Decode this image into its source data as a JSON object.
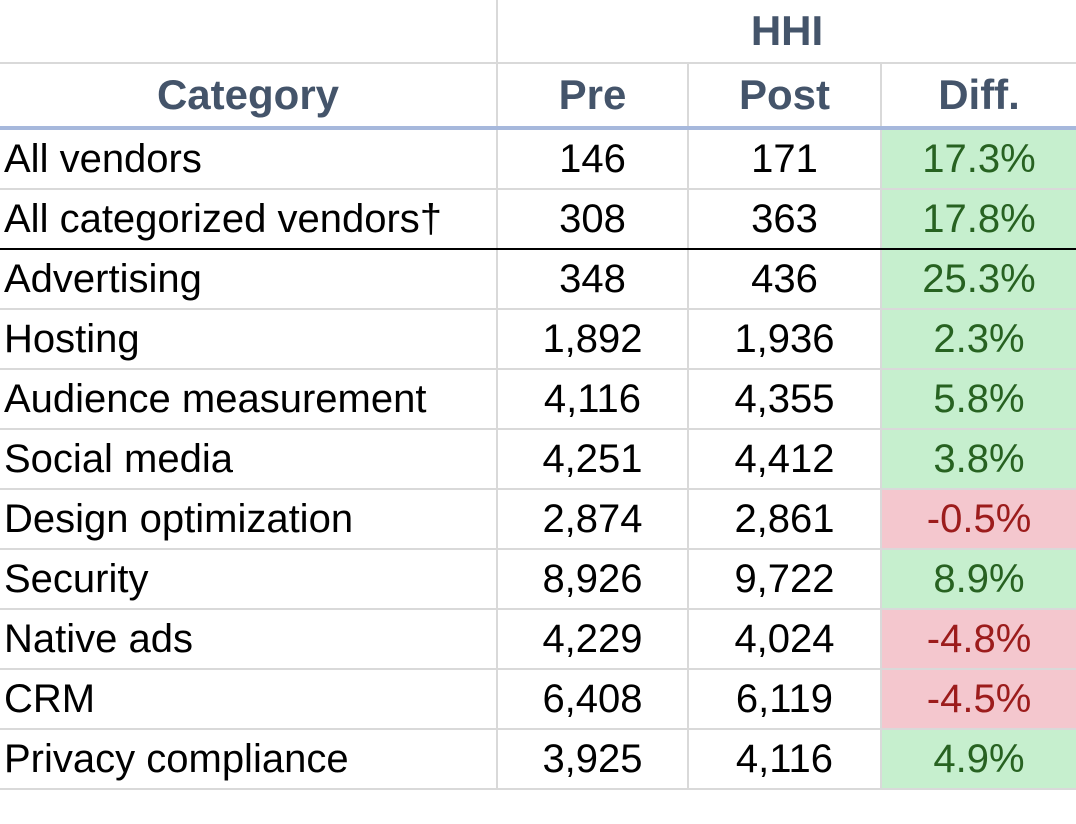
{
  "table": {
    "group_header": "HHI",
    "columns": [
      "Category",
      "Pre",
      "Post",
      "Diff."
    ],
    "rows": [
      {
        "category": "All vendors",
        "pre": "146",
        "post": "171",
        "diff": "17.3%",
        "sign": "pos"
      },
      {
        "category": "All categorized vendors†",
        "pre": "308",
        "post": "363",
        "diff": "17.8%",
        "sign": "pos"
      },
      {
        "category": "Advertising",
        "pre": "348",
        "post": "436",
        "diff": "25.3%",
        "sign": "pos"
      },
      {
        "category": "Hosting",
        "pre": "1,892",
        "post": "1,936",
        "diff": "2.3%",
        "sign": "pos"
      },
      {
        "category": "Audience measurement",
        "pre": "4,116",
        "post": "4,355",
        "diff": "5.8%",
        "sign": "pos"
      },
      {
        "category": "Social media",
        "pre": "4,251",
        "post": "4,412",
        "diff": "3.8%",
        "sign": "pos"
      },
      {
        "category": "Design optimization",
        "pre": "2,874",
        "post": "2,861",
        "diff": "-0.5%",
        "sign": "neg"
      },
      {
        "category": "Security",
        "pre": "8,926",
        "post": "9,722",
        "diff": "8.9%",
        "sign": "pos"
      },
      {
        "category": "Native ads",
        "pre": "4,229",
        "post": "4,024",
        "diff": "-4.8%",
        "sign": "neg"
      },
      {
        "category": "CRM",
        "pre": "6,408",
        "post": "6,119",
        "diff": "-4.5%",
        "sign": "neg"
      },
      {
        "category": "Privacy compliance",
        "pre": "3,925",
        "post": "4,116",
        "diff": "4.9%",
        "sign": "pos"
      }
    ]
  },
  "colors": {
    "header_text": "#44546a",
    "header_rule": "#a6b8dc",
    "positive_fill": "#c6efce",
    "positive_text": "#276221",
    "negative_fill": "#f4c7ce",
    "negative_text": "#9c1c1c"
  }
}
